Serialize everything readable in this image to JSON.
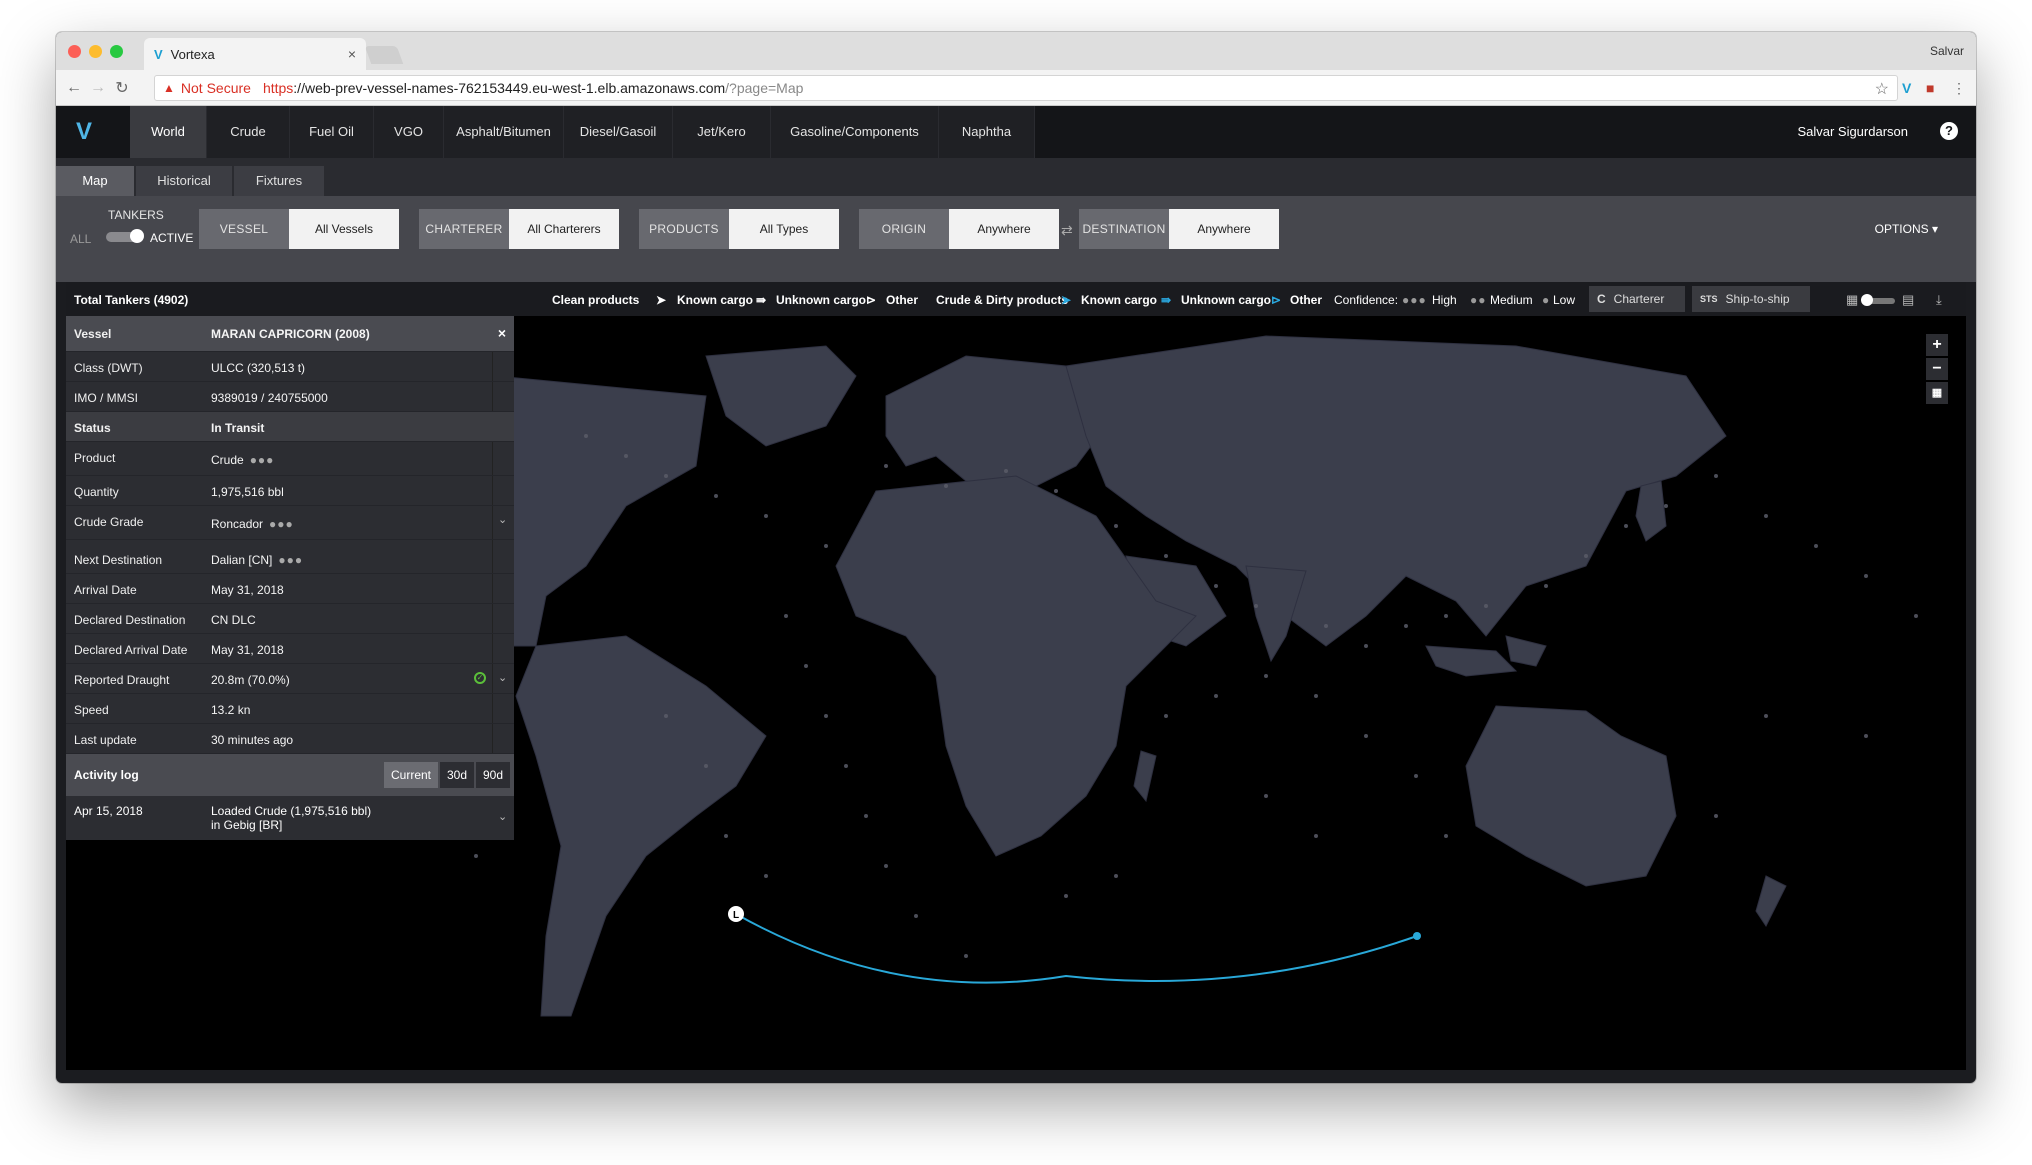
{
  "browser": {
    "tab_title": "Vortexa",
    "tab_close": "×",
    "profile": "Salvar",
    "security": "Not Secure",
    "url_scheme": "https",
    "url_host": "://web-prev-vessel-names-762153449.eu-west-1.elb.amazonaws.com",
    "url_path": "/?page=Map"
  },
  "app": {
    "logo": "V",
    "main_tabs": [
      "World",
      "Crude",
      "Fuel Oil",
      "VGO",
      "Asphalt/Bitumen",
      "Diesel/Gasoil",
      "Jet/Kero",
      "Gasoline/Components",
      "Naphtha"
    ],
    "active_tab": "World",
    "user_name": "Salvar Sigurdarson",
    "help": "?"
  },
  "sub_tabs": [
    "Map",
    "Historical",
    "Fixtures"
  ],
  "filters": {
    "tankers_label": "TANKERS",
    "toggle_all": "ALL",
    "toggle_active": "ACTIVE",
    "vessel": {
      "key": "VESSEL",
      "value": "All Vessels"
    },
    "charterer": {
      "key": "CHARTERER",
      "value": "All Charterers"
    },
    "products": {
      "key": "PRODUCTS",
      "value": "All Types"
    },
    "origin": {
      "key": "ORIGIN",
      "value": "Anywhere"
    },
    "eq": "⇄",
    "destination": {
      "key": "DESTINATION",
      "value": "Anywhere"
    },
    "options": "OPTIONS ▾"
  },
  "legend": {
    "total": "Total Tankers (4902)",
    "clean_products": "Clean products",
    "dirty_products": "Crude & Dirty products",
    "known_cargo": "Known cargo",
    "unknown_cargo": "Unknown cargo",
    "other": "Other",
    "confidence": "Confidence:",
    "high": "High",
    "medium": "Medium",
    "low": "Low",
    "charterer_btn": "Charterer",
    "charterer_icon": "C",
    "sts_icon": "STS",
    "sts_btn": "Ship-to-ship"
  },
  "vessel_panel": {
    "header_key": "Vessel",
    "header_value": "MARAN CAPRICORN (2008)",
    "close": "×",
    "rows": [
      {
        "key": "Class (DWT)",
        "value": "ULCC (320,513 t)"
      },
      {
        "key": "IMO / MMSI",
        "value": "9389019 / 240755000"
      },
      {
        "key": "Status",
        "value": "In Transit"
      },
      {
        "key": "Product",
        "value": "Crude"
      },
      {
        "key": "Quantity",
        "value": "1,975,516 bbl"
      },
      {
        "key": "Crude Grade",
        "value": "Roncador"
      },
      {
        "key": "Next Destination",
        "value": "Dalian [CN]"
      },
      {
        "key": "Arrival Date",
        "value": "May 31, 2018"
      },
      {
        "key": "Declared Destination",
        "value": "CN DLC"
      },
      {
        "key": "Declared Arrival Date",
        "value": "May 31, 2018"
      },
      {
        "key": "Reported Draught",
        "value": "20.8m (70.0%)"
      },
      {
        "key": "Speed",
        "value": "13.2 kn"
      },
      {
        "key": "Last update",
        "value": "30 minutes ago"
      }
    ],
    "activity_title": "Activity log",
    "activity_buttons": [
      "Current",
      "30d",
      "90d"
    ],
    "log": [
      {
        "date": "Apr 15, 2018",
        "line1": "Loaded Crude (1,975,516 bbl)",
        "line2": "in Gebig [BR]"
      }
    ]
  },
  "map": {
    "route_start_marker": "L",
    "zoom_in": "+",
    "zoom_out": "−",
    "colors": {
      "route": "#29a8d8",
      "land": "#3b3e4c",
      "ocean": "#000000",
      "ships": "#5a5c68"
    }
  }
}
